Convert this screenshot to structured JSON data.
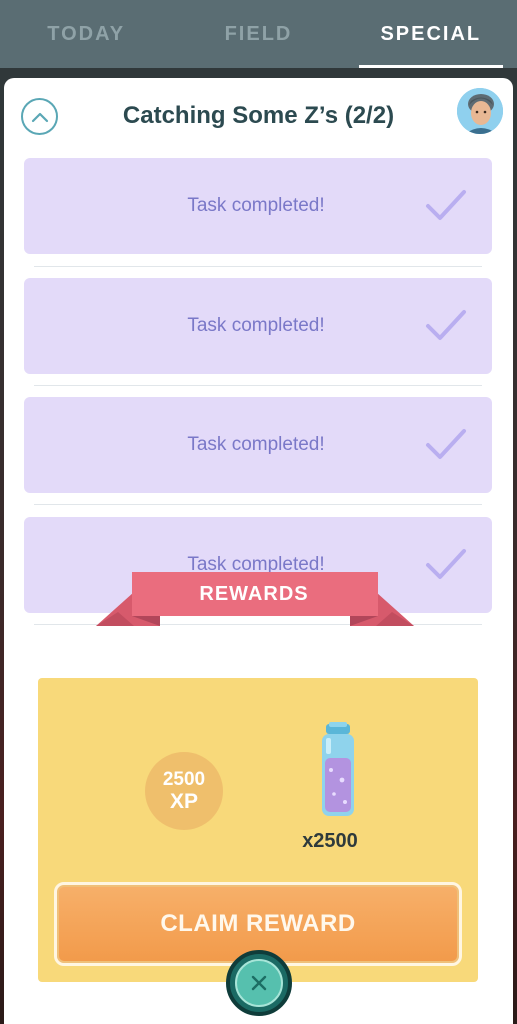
{
  "tabs": [
    {
      "label": "TODAY",
      "active": false
    },
    {
      "label": "FIELD",
      "active": false
    },
    {
      "label": "SPECIAL",
      "active": true
    }
  ],
  "research": {
    "title": "Catching Some Z’s (2/2)",
    "tasks": [
      {
        "status": "Task completed!"
      },
      {
        "status": "Task completed!"
      },
      {
        "status": "Task completed!"
      },
      {
        "status": "Task completed!"
      }
    ]
  },
  "rewards": {
    "header": "REWARDS",
    "xp": {
      "amount": "2500",
      "unit": "XP"
    },
    "item": {
      "icon": "stardust-bottle-icon",
      "quantity": "x2500"
    },
    "claim_label": "CLAIM REWARD"
  },
  "colors": {
    "task_bg": "#e3daf9",
    "task_text": "#7a78c8",
    "rewards_bg": "#f8d97a",
    "ribbon": "#ea6d7e",
    "claim_button": "#f29a4a",
    "close_button": "#56c0ae"
  }
}
